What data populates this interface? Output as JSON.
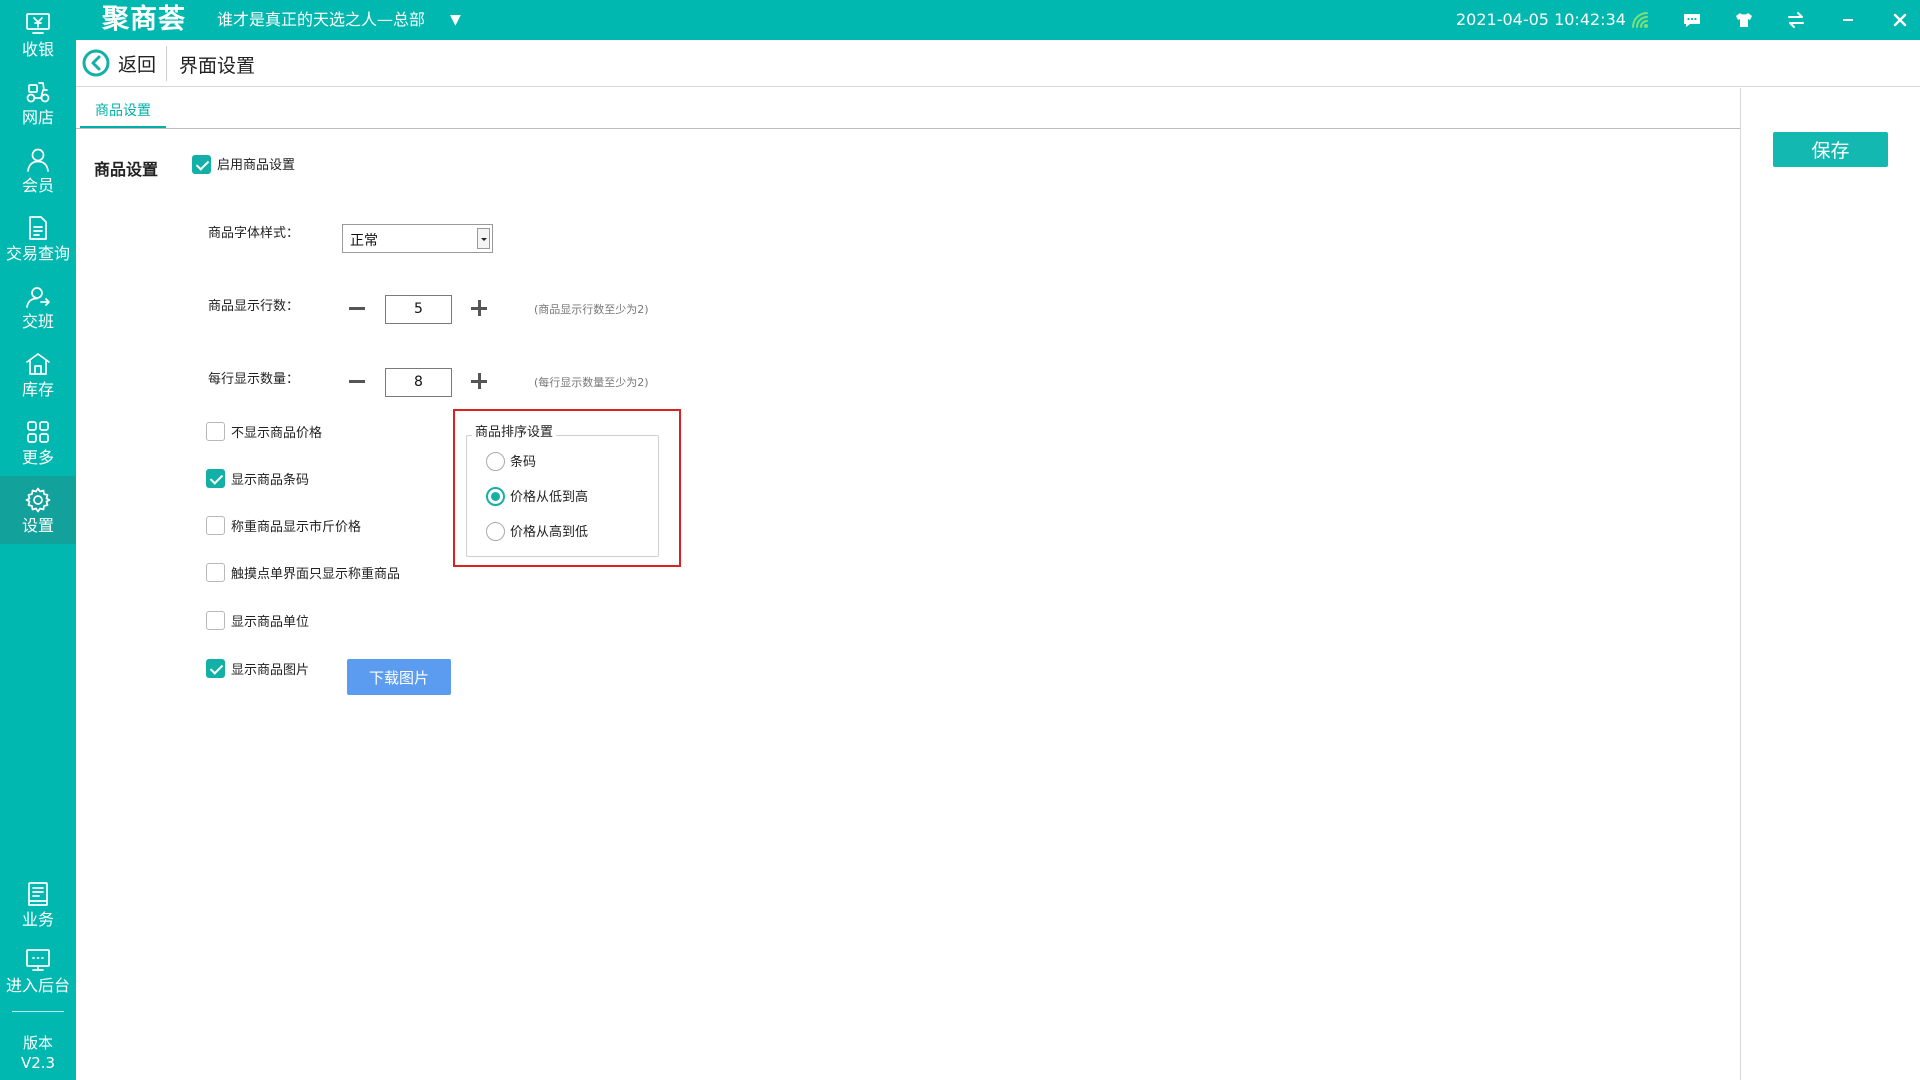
{
  "app": {
    "logo": "聚商荟",
    "store_name": "谁才是真正的天选之人—总部",
    "datetime": "2021-04-05 10:42:34",
    "accent_color": "#00b8b0",
    "topbar_icons": [
      "wifi-signal-icon",
      "message-icon",
      "shirt-skin-icon",
      "sync-icon",
      "minimize-icon",
      "close-icon"
    ]
  },
  "sidebar": {
    "items": [
      {
        "label": "收银",
        "icon": "cashier-icon"
      },
      {
        "label": "网店",
        "icon": "delivery-icon"
      },
      {
        "label": "会员",
        "icon": "member-icon"
      },
      {
        "label": "交易查询",
        "icon": "transaction-icon"
      },
      {
        "label": "交班",
        "icon": "shift-icon"
      },
      {
        "label": "库存",
        "icon": "inventory-icon"
      },
      {
        "label": "更多",
        "icon": "more-icon"
      },
      {
        "label": "设置",
        "icon": "settings-icon",
        "active": true
      },
      {
        "label": "业务",
        "icon": "business-icon"
      },
      {
        "label": "进入后台",
        "icon": "backend-icon"
      }
    ],
    "version_label": "版本",
    "version_number": "V2.3"
  },
  "header": {
    "back_label": "返回",
    "page_title": "界面设置"
  },
  "main": {
    "tab": "商品设置",
    "save_label": "保存",
    "section_title": "商品设置",
    "enable": {
      "label": "启用商品设置",
      "checked": true
    },
    "font_style": {
      "label": "商品字体样式：",
      "value": "正常"
    },
    "rows": {
      "label": "商品显示行数：",
      "value": "5",
      "hint": "(商品显示行数至少为2)"
    },
    "per_row": {
      "label": "每行显示数量：",
      "value": "8",
      "hint": "(每行显示数量至少为2)"
    },
    "options": [
      {
        "label": "不显示商品价格",
        "checked": false
      },
      {
        "label": "显示商品条码",
        "checked": true
      },
      {
        "label": "称重商品显示市斤价格",
        "checked": false
      },
      {
        "label": "触摸点单界面只显示称重商品",
        "checked": false
      },
      {
        "label": "显示商品单位",
        "checked": false
      },
      {
        "label": "显示商品图片",
        "checked": true
      }
    ],
    "download_label": "下载图片",
    "sort": {
      "title": "商品排序设置",
      "options": [
        {
          "label": "条码",
          "checked": false
        },
        {
          "label": "价格从低到高",
          "checked": true
        },
        {
          "label": "价格从高到低",
          "checked": false
        }
      ]
    }
  }
}
